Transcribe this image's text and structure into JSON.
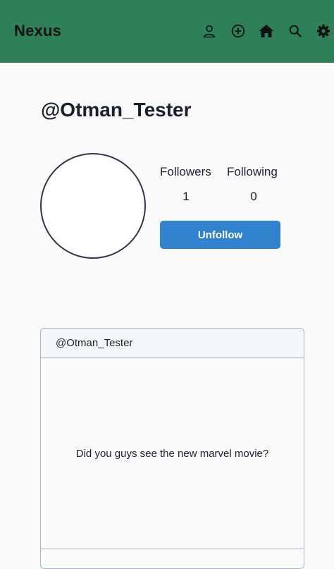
{
  "nav": {
    "brand": "Nexus",
    "icons": [
      "user-icon",
      "plus-circle-icon",
      "home-icon",
      "search-icon",
      "gear-icon"
    ]
  },
  "colors": {
    "navbar": "#2d8057",
    "button": "#3182ce",
    "background": "#fafafa"
  },
  "profile": {
    "username": "@Otman_Tester",
    "followers_label": "Followers",
    "followers_count": "1",
    "following_label": "Following",
    "following_count": "0",
    "unfollow_label": "Unfollow"
  },
  "posts": [
    {
      "author": "@Otman_Tester",
      "content": "Did you guys see the new marvel movie?"
    }
  ]
}
